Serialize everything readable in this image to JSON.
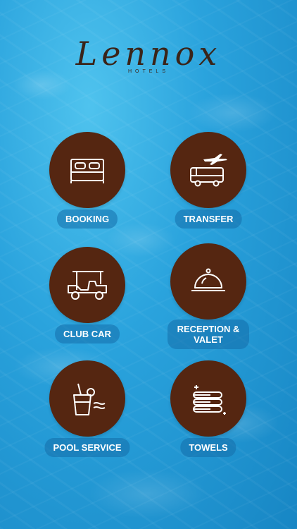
{
  "brand": {
    "name": "Lennox",
    "sub": "HOTELS"
  },
  "tiles": [
    {
      "label": "BOOKING",
      "icon": "bed-icon"
    },
    {
      "label": "TRANSFER",
      "icon": "plane-bus-icon"
    },
    {
      "label": "CLUB CAR",
      "icon": "golf-cart-icon"
    },
    {
      "label": "RECEPTION & VALET",
      "icon": "cloche-icon"
    },
    {
      "label": "POOL SERVICE",
      "icon": "drink-icon"
    },
    {
      "label": "TOWELS",
      "icon": "towels-icon"
    }
  ],
  "colors": {
    "circle": "#552611",
    "logo": "#3a2419"
  }
}
